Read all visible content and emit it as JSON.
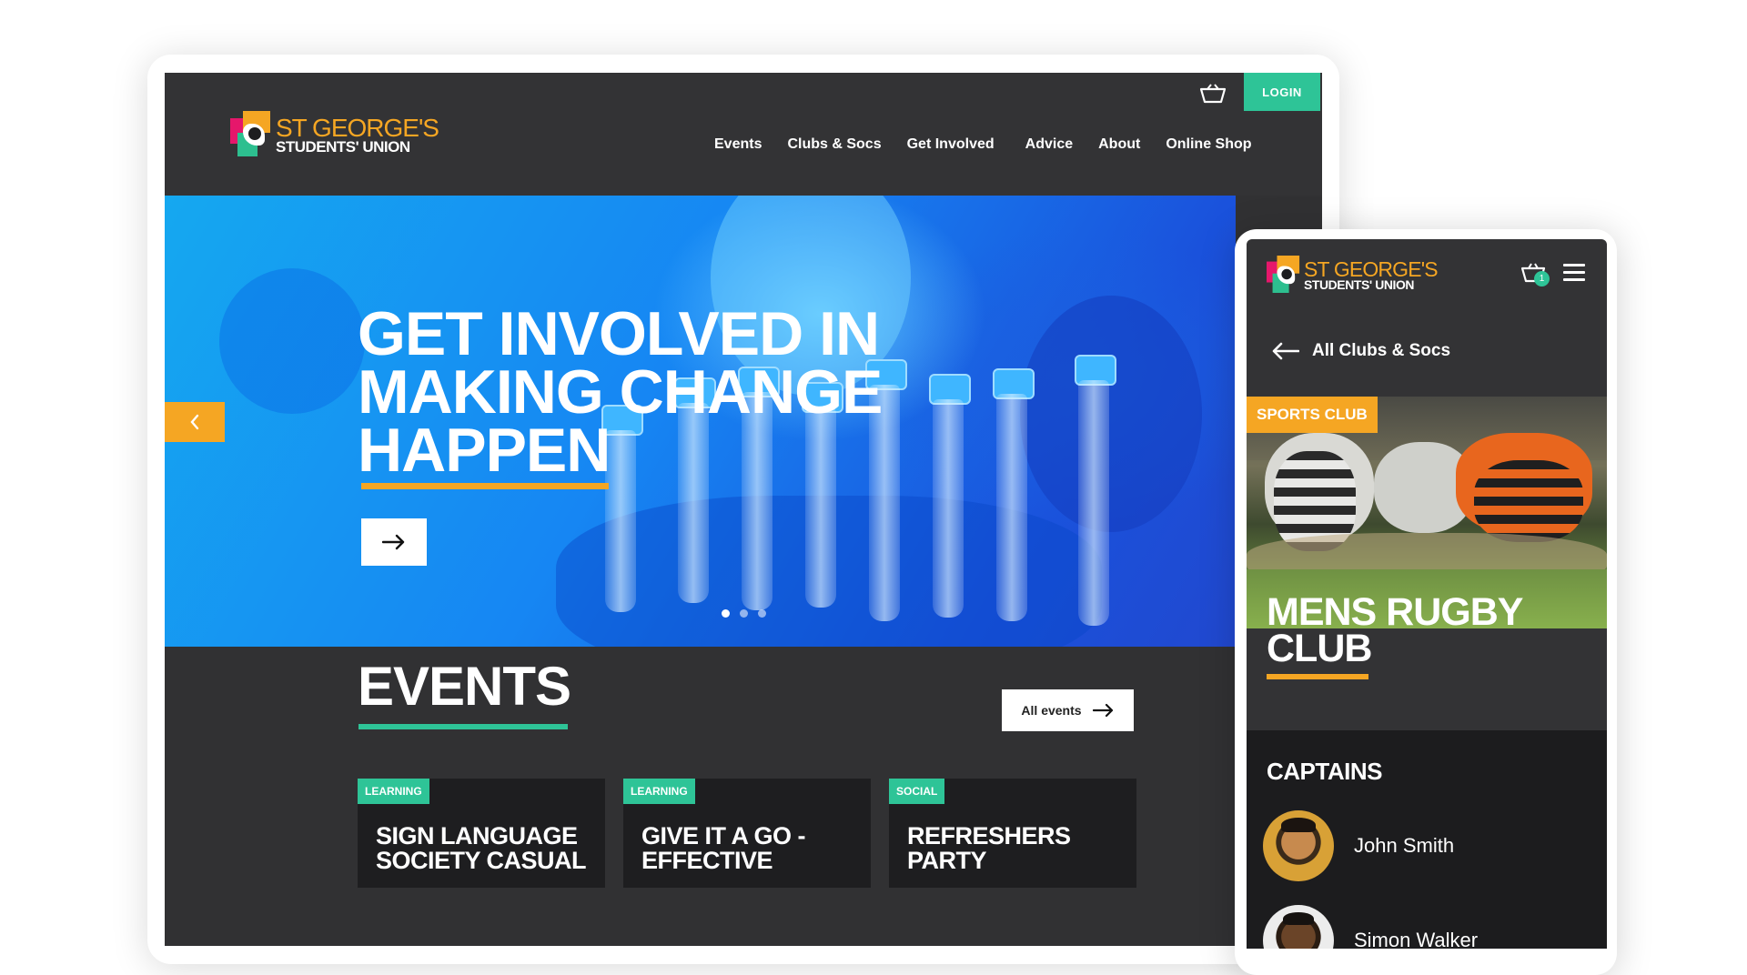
{
  "brand": {
    "line1": "ST GEORGE'S",
    "line2": "STUDENTS' UNION",
    "colors": {
      "accent_green": "#2ec497",
      "accent_orange": "#f5a623",
      "accent_pink": "#e6176b",
      "dark_bg": "#313133"
    }
  },
  "desktop": {
    "header": {
      "login_label": "LOGIN",
      "basket_icon": "basket-icon",
      "nav": [
        "Events",
        "Clubs & Socs",
        "Get Involved",
        "Advice",
        "About",
        "Online Shop"
      ]
    },
    "hero": {
      "title_lines": [
        "GET INVOLVED IN",
        "MAKING CHANGE",
        "HAPPEN"
      ],
      "arrow_icon": "arrow-right-icon",
      "prev_icon": "chevron-left-icon",
      "slides_total": 3,
      "active_slide": 1
    },
    "events": {
      "title": "EVENTS",
      "all_events_label": "All events",
      "cards": [
        {
          "tag": "LEARNING",
          "title": "SIGN LANGUAGE SOCIETY CASUAL"
        },
        {
          "tag": "LEARNING",
          "title": "GIVE IT A GO - EFFECTIVE"
        },
        {
          "tag": "SOCIAL",
          "title": "REFRESHERS PARTY"
        }
      ]
    }
  },
  "mobile": {
    "basket_count": "1",
    "back_label": "All Clubs & Socs",
    "club_tag": "SPORTS CLUB",
    "club_title_lines": [
      "MENS RUGBY",
      "CLUB"
    ],
    "captains_title": "CAPTAINS",
    "captains": [
      {
        "name": "John Smith"
      },
      {
        "name": "Simon Walker"
      }
    ]
  }
}
